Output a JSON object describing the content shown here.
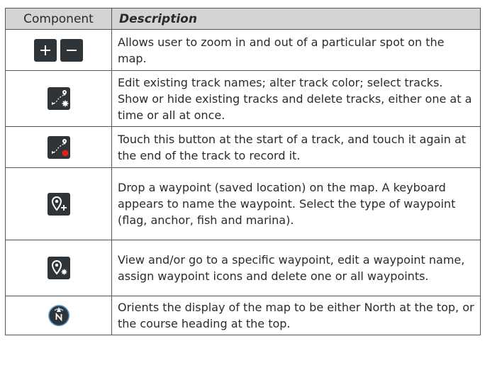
{
  "table": {
    "headers": [
      "Component",
      "Description"
    ],
    "rows": [
      {
        "icon": [
          "zoom-in-icon",
          "zoom-out-icon"
        ],
        "description": "Allows user to zoom in and out of a particular spot on the map."
      },
      {
        "icon": "track-settings-icon",
        "description": "Edit existing track names; alter track color; select tracks. Show or hide existing tracks and delete tracks, either one at a time or all at once."
      },
      {
        "icon": "track-record-icon",
        "description": "Touch this button at the start of a track, and touch it again at the end of the track to record it."
      },
      {
        "icon": "waypoint-add-icon",
        "description": "Drop a waypoint (saved location) on the map. A keyboard appears to name the waypoint. Select the type of waypoint (flag, anchor, fish and marina)."
      },
      {
        "icon": "waypoint-settings-icon",
        "description": "View and/or go to a specific waypoint, edit a waypoint name, assign waypoint icons and delete one or all waypoints."
      },
      {
        "icon": "compass-north-icon",
        "description": "Orients the display of the map to be either North at the top, or the course heading at the top."
      }
    ]
  },
  "colors": {
    "header_bg": "#d4d4d4",
    "button_bg": "#2f3439",
    "record_red": "#e02020",
    "compass_blue": "#2f78b8"
  }
}
